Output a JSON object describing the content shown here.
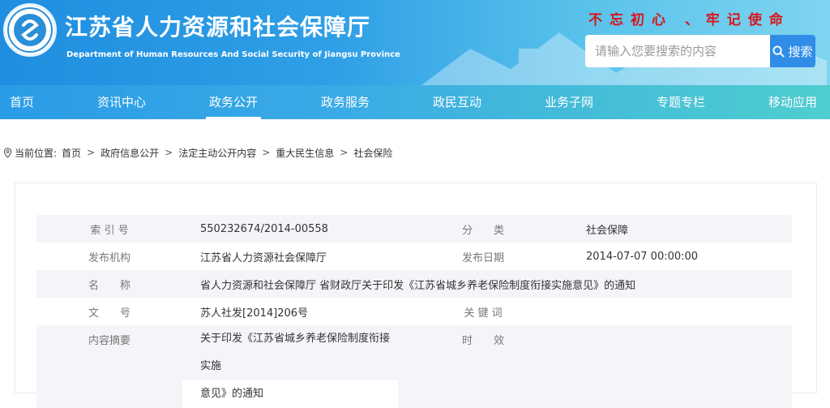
{
  "header": {
    "title": "江苏省人力资源和社会保障厅",
    "subtitle": "Department of Human Resources And Social Security of Jiangsu Province",
    "slogan": "不忘初心 、牢记使命",
    "brand_color": "#1f8ee0",
    "accent_red": "#d9151c"
  },
  "search": {
    "placeholder": "请输入您要搜索的内容",
    "button_label": "搜索",
    "icon": "search-icon"
  },
  "nav": {
    "items": [
      {
        "label": "首页"
      },
      {
        "label": "资讯中心"
      },
      {
        "label": "政务公开",
        "active": true
      },
      {
        "label": "政务服务"
      },
      {
        "label": "政民互动"
      },
      {
        "label": "业务子网"
      },
      {
        "label": "专题专栏"
      },
      {
        "label": "移动应用"
      }
    ]
  },
  "breadcrumb": {
    "prefix": "当前位置:",
    "icon": "location-pin-icon",
    "separator": ">",
    "items": [
      "首页",
      "政府信息公开",
      "法定主动公开内容",
      "重大民生信息",
      "社会保险"
    ]
  },
  "info": {
    "index_label": "索 引 号",
    "index_value": "550232674/2014-00558",
    "category_label": "分　　类",
    "category_value": "社会保障",
    "publisher_label": "发布机构",
    "publisher_value": "江苏省人力资源社会保障厅",
    "date_label": "发布日期",
    "date_value": "2014-07-07 00:00:00",
    "name_label": "名　　称",
    "name_value": "省人力资源和社会保障厅 省财政厅关于印发《江苏省城乡养老保险制度衔接实施意见》的通知",
    "docno_label": "文　　号",
    "docno_value": "苏人社发[2014]206号",
    "keywords_label": "关 键 词",
    "keywords_value": "",
    "summary_label": "内容摘要",
    "summary_value_line1": "关于印发《江苏省城乡养老保险制度衔接实施",
    "summary_value_line2": "意见》的通知",
    "validity_label": "时　　效",
    "validity_value": ""
  }
}
